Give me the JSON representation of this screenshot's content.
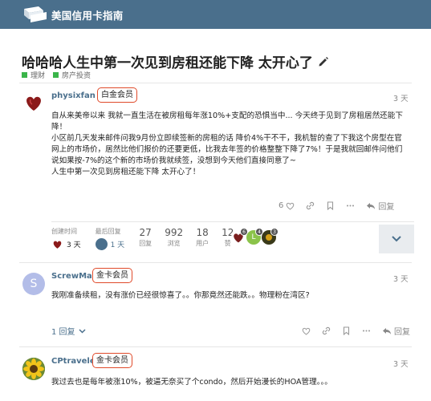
{
  "header": {
    "site_title": "美国信用卡指南"
  },
  "topic": {
    "title": "哈哈哈人生中第一次见到房租还能下降 太开心了"
  },
  "categories": [
    {
      "label": "理财",
      "color": "#3ab54a"
    },
    {
      "label": "房产投资",
      "color": "#3ab54a"
    }
  ],
  "posts": [
    {
      "username": "physixfan",
      "badge": "白金会员",
      "time": "3 天",
      "body": [
        "自从来美帝以来 我就一直生活在被房租每年涨10%+支配的恐惧当中... 今天终于见到了房租居然还能下",
        "降！",
        "小区前几天发来邮件问我9月份立即续签新的房租的话 降价4%干不干，我机智的查了下我这个房型在官",
        "网上的市场价，居然比他们报价的还要更低，比我去年签的价格整整下降了7%！于是我就回邮件问他们",
        "说如果按-7%的这个新的市场价我就续签，没想到今天他们直接同意了~",
        "人生中第一次见到房租还能下降 太开心了！"
      ],
      "likes": "6",
      "reply_label": "回复"
    },
    {
      "username": "ScrewMan",
      "avatar_letter": "S",
      "badge": "金卡会员",
      "time": "3 天",
      "body": [
        "我刚准备续租，没有涨价已经很惊喜了。。你那竟然还能跌。。物理粉在湾区?"
      ],
      "replies": "1 回复",
      "reply_label": "回复"
    },
    {
      "username": "CPtraveler",
      "badge": "金卡会员",
      "time": "3 天",
      "body": [
        "我过去也是每年被涨10%，被逼无奈买了个condo，然后开始漫长的HOA管理。。。"
      ]
    }
  ],
  "stats": {
    "created_label": "创建时间",
    "created_value": "3 天",
    "last_reply_label": "最后回复",
    "last_reply_value": "1 天",
    "replies": {
      "value": "27",
      "label": "回复"
    },
    "views": {
      "value": "992",
      "label": "浏览"
    },
    "users": {
      "value": "18",
      "label": "用户"
    },
    "likes": {
      "value": "12",
      "label": "赞"
    },
    "participants": [
      {
        "count": "6",
        "color": "#7a1f1f"
      },
      {
        "count": "4",
        "color": "#8bc34a",
        "letter": "L"
      },
      {
        "count": "3",
        "color": "#3a3a1a"
      }
    ]
  },
  "colors": {
    "header_bg": "#4a6f8c",
    "link": "#4a6f8c",
    "badge_border": "#e04a2a"
  }
}
